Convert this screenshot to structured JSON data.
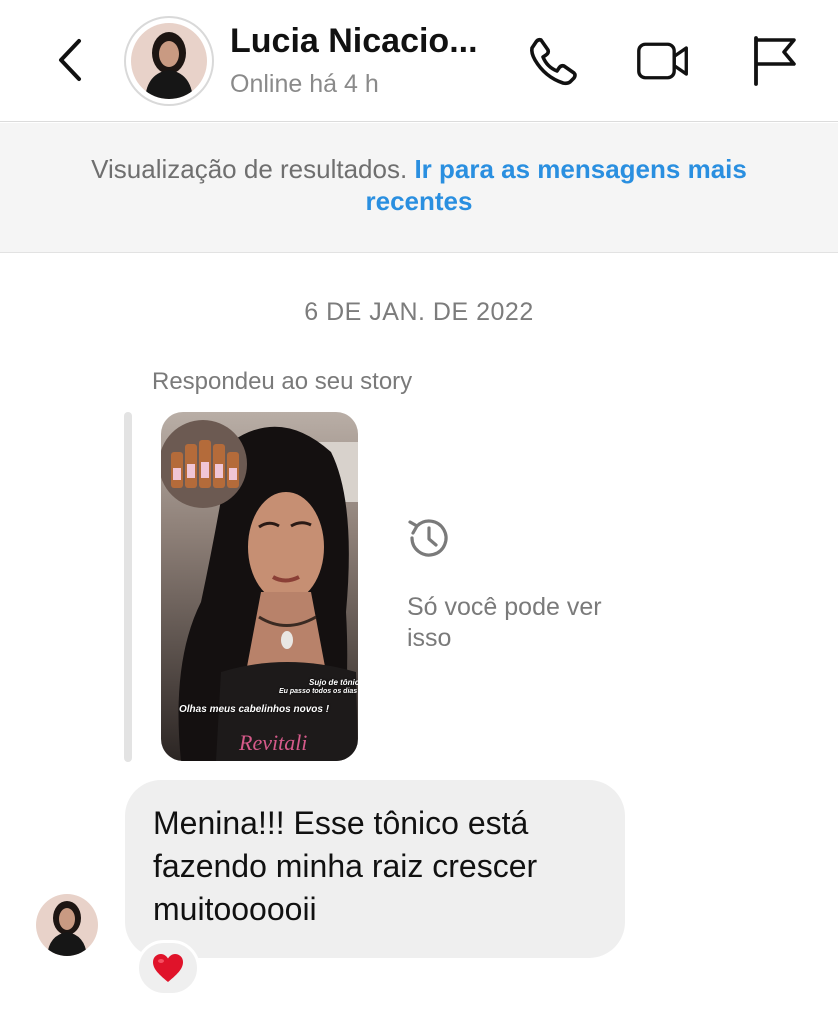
{
  "header": {
    "contact_name": "Lucia Nicacio...",
    "status": "Online há 4 h"
  },
  "banner": {
    "text": "Visualização de resultados.",
    "link": "Ir para as mensagens mais recentes"
  },
  "conversation": {
    "date": "6 DE JAN. DE 2022",
    "story_reply_label": "Respondeu ao seu story",
    "story": {
      "caption_small_1": "Sujo de tônico",
      "caption_small_2": "Eu passo todos os dias",
      "caption_main": "Olhas meus cabelinhos novos !"
    },
    "expired_notice": "Só você pode ver isso",
    "message": "Menina!!! Esse tônico está fazendo minha raiz crescer muitoooooii",
    "reaction": "❤️"
  },
  "icons": [
    "back-arrow-icon",
    "phone-icon",
    "video-camera-icon",
    "flag-icon",
    "history-clock-icon",
    "heart-icon"
  ]
}
